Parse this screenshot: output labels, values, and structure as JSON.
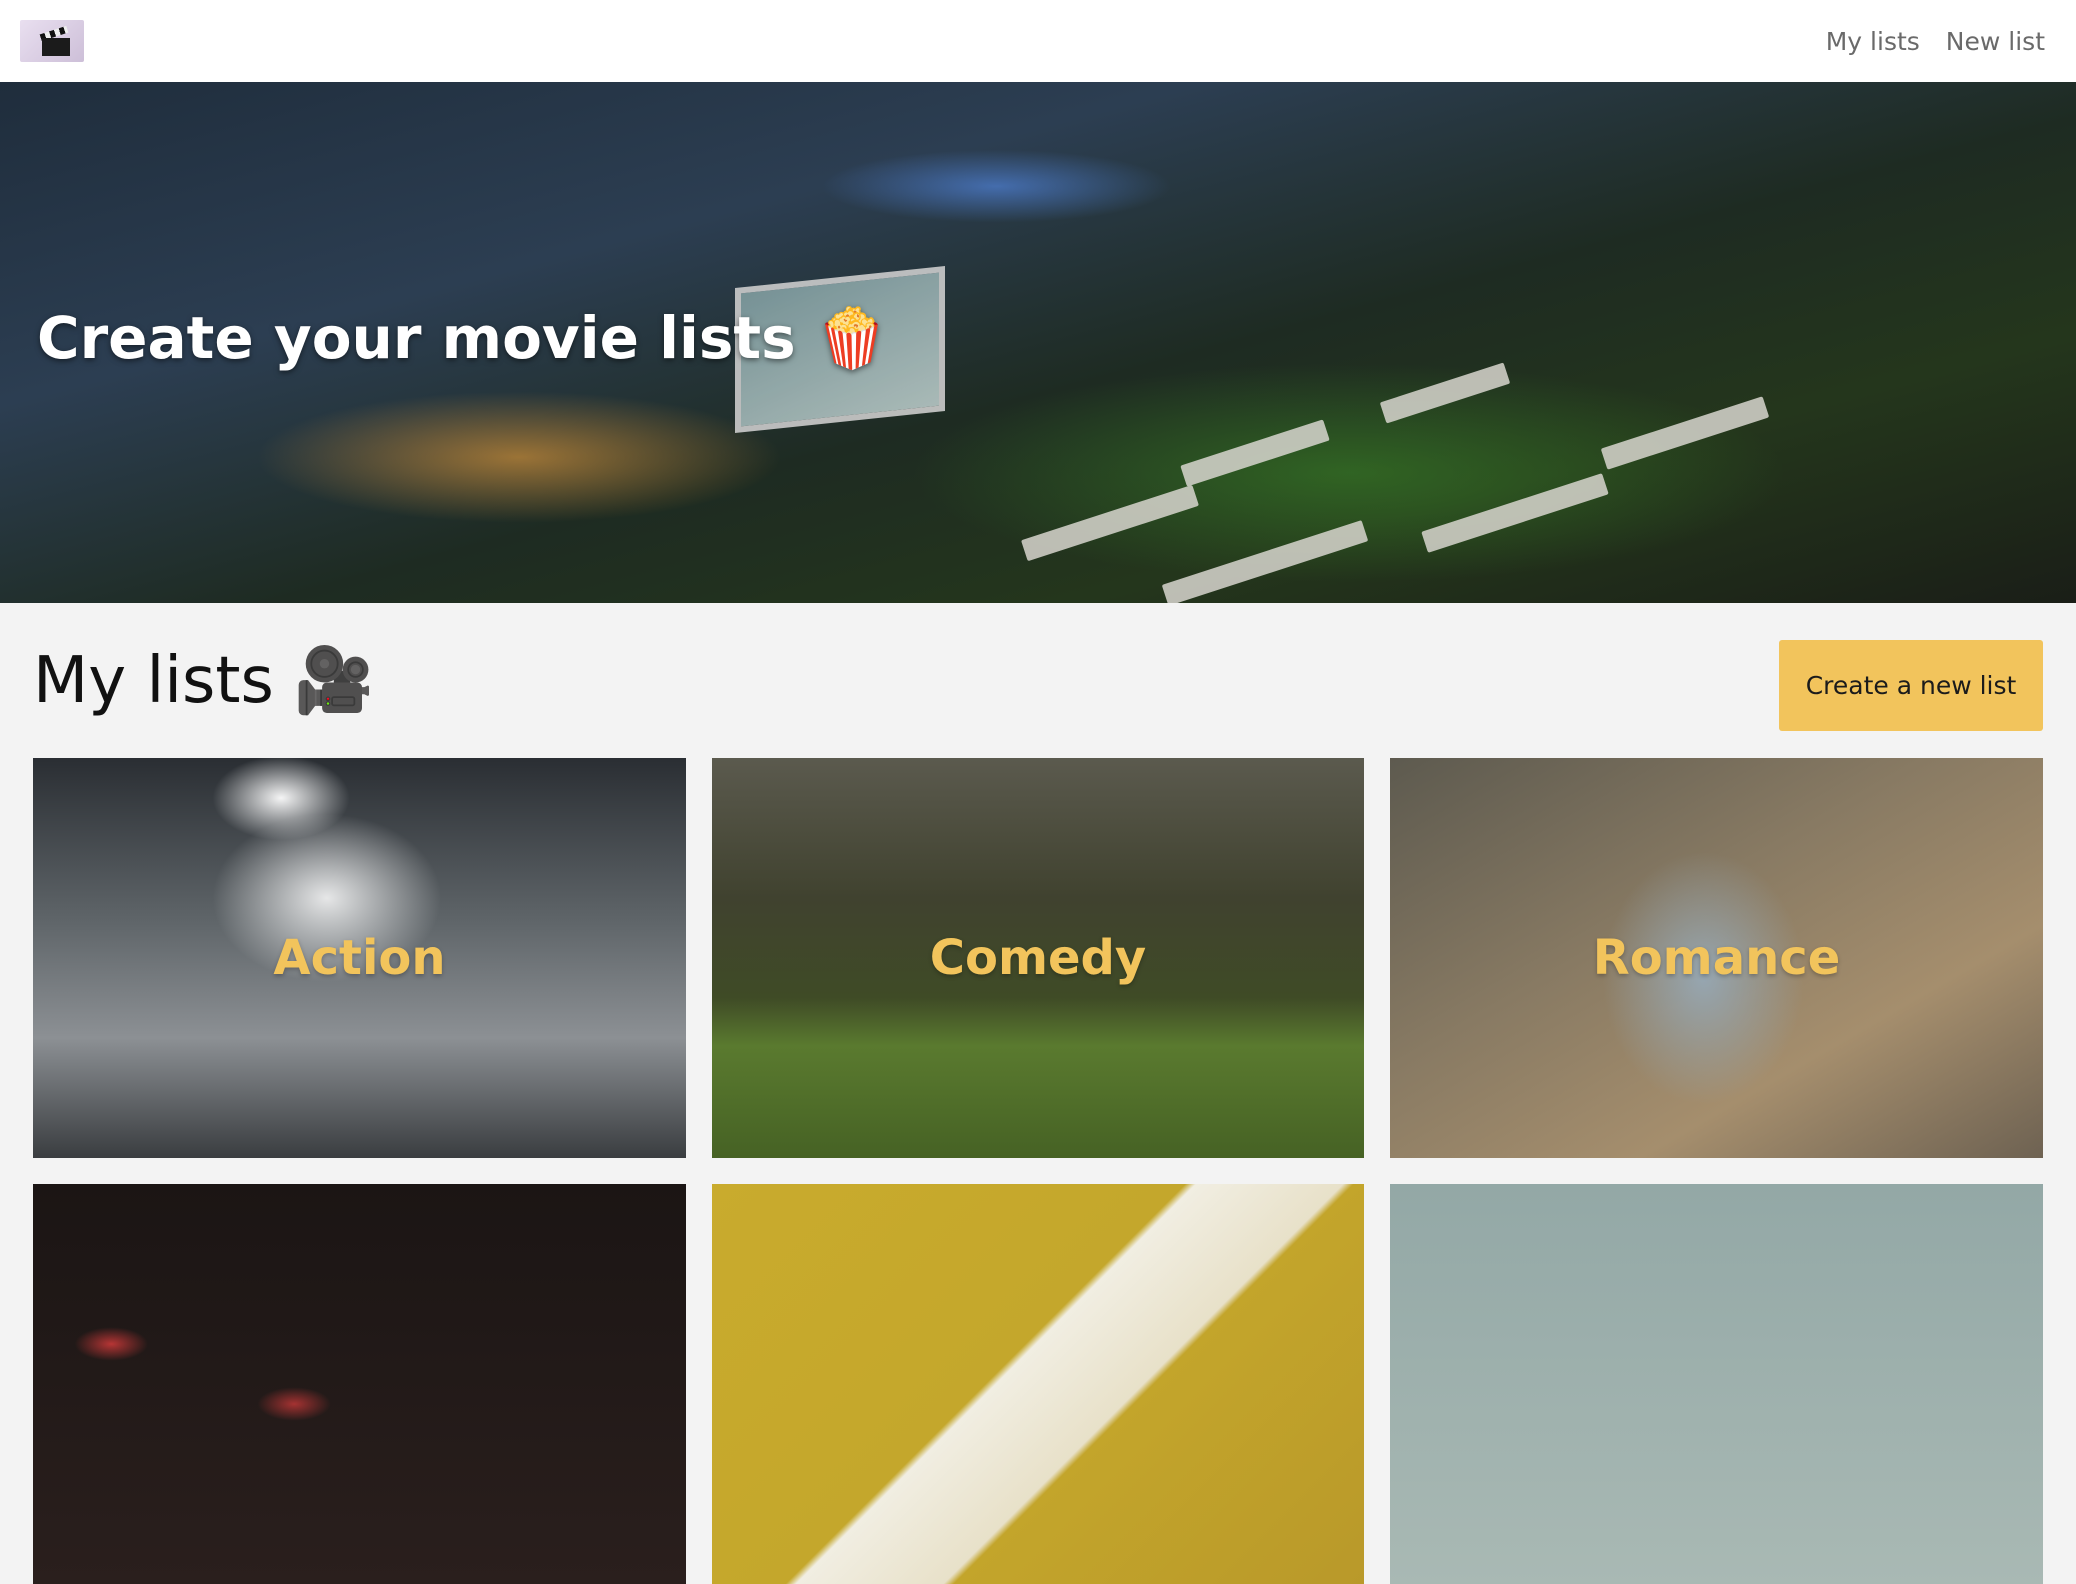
{
  "navbar": {
    "logo_icon": "clapperboard-icon",
    "links": [
      {
        "label": "My lists"
      },
      {
        "label": "New list"
      }
    ]
  },
  "hero": {
    "title": "Create your movie lists 🍿"
  },
  "section": {
    "title": "My lists 🎥",
    "create_button": "Create a new list"
  },
  "lists": [
    {
      "label": "Action"
    },
    {
      "label": "Comedy"
    },
    {
      "label": "Romance"
    },
    {
      "label": ""
    },
    {
      "label": ""
    },
    {
      "label": ""
    }
  ],
  "colors": {
    "accent": "#f2c45c",
    "background": "#f3f3f3",
    "nav_link": "#6a6a6a"
  }
}
